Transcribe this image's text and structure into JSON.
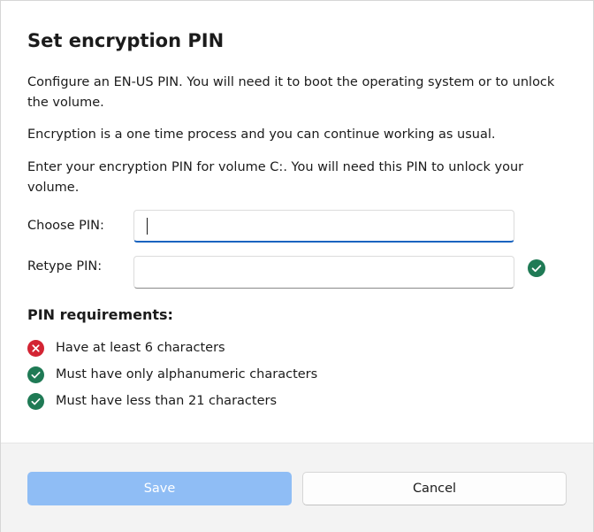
{
  "dialog": {
    "title": "Set encryption PIN",
    "paragraph_1": "Configure an EN-US PIN. You will need it to boot the operating system or to unlock the volume.",
    "paragraph_2": "Encryption is a one time process and you can continue working as usual.",
    "paragraph_3": "Enter your encryption PIN for volume C:. You will need this PIN to unlock your volume."
  },
  "fields": {
    "choose_pin": {
      "label": "Choose PIN:",
      "value": ""
    },
    "retype_pin": {
      "label": "Retype PIN:",
      "value": "",
      "status": "valid"
    }
  },
  "requirements": {
    "heading": "PIN requirements:",
    "items": [
      {
        "text": "Have at least 6 characters",
        "status": "fail",
        "icon": "error-icon"
      },
      {
        "text": "Must have only alphanumeric characters",
        "status": "pass",
        "icon": "check-icon"
      },
      {
        "text": "Must have less than 21 characters",
        "status": "pass",
        "icon": "check-icon"
      }
    ]
  },
  "footer": {
    "save_label": "Save",
    "save_enabled": false,
    "cancel_label": "Cancel"
  },
  "colors": {
    "accent": "#1a64c0",
    "save_disabled": "#8fbdf5",
    "success": "#1f7a55",
    "error": "#d32433",
    "footer_bg": "#f3f3f3"
  }
}
